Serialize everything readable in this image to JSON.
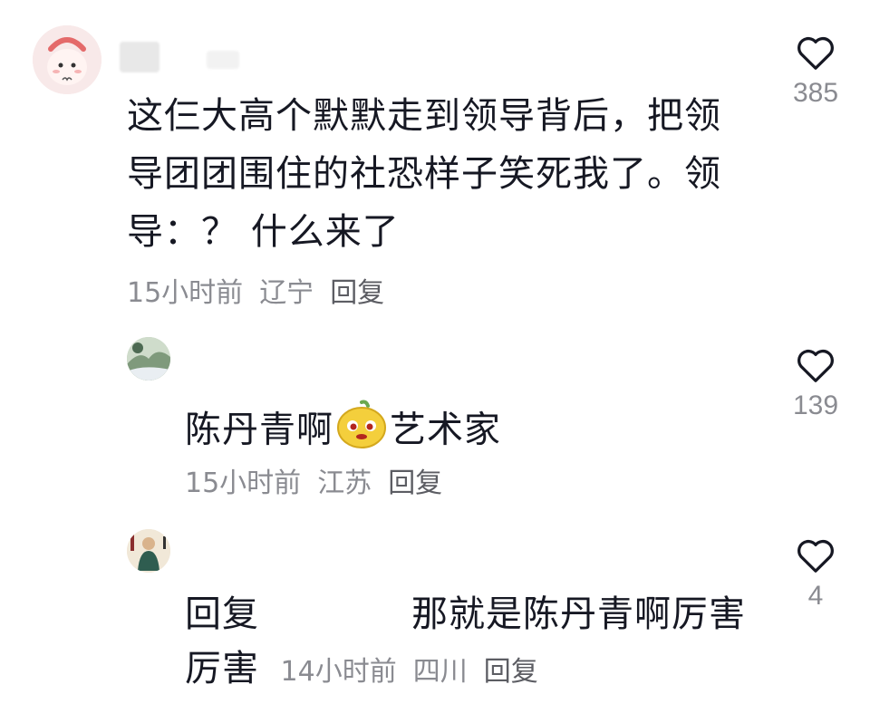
{
  "comments": [
    {
      "text": "这仨大高个默默走到领导背后，把领导团团围住的社恐样子笑死我了。领导：？ 什么来了",
      "time": "15小时前",
      "location": "辽宁",
      "reply": "回复",
      "likes": "385",
      "avatar_icon": "cartoon-face-avatar"
    },
    {
      "text_before": "陈丹青啊",
      "emoji_icon": "pear-emoji",
      "text_after": "艺术家",
      "time": "15小时前",
      "location": "江苏",
      "reply": "回复",
      "likes": "139",
      "avatar_icon": "landscape-avatar"
    },
    {
      "reply_prefix": "回复",
      "text": "那就是陈丹青啊厉害厉害",
      "time": "14小时前",
      "location": "四川",
      "reply": "回复",
      "likes": "4",
      "avatar_icon": "painting-avatar"
    }
  ],
  "colors": {
    "text": "#161823",
    "meta": "#8a8b91",
    "background": "#ffffff"
  }
}
